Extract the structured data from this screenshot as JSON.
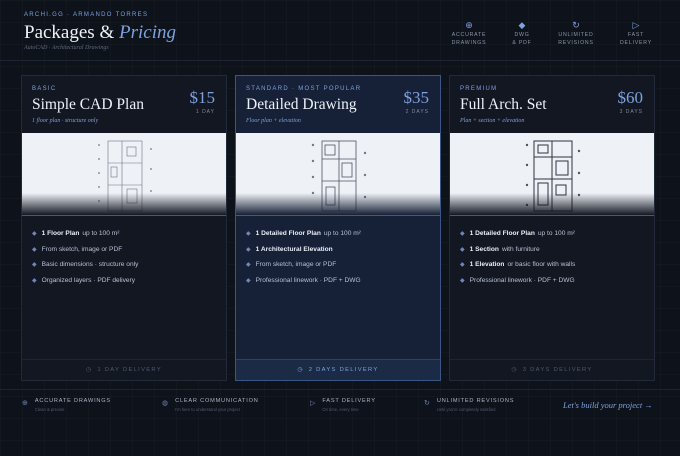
{
  "header": {
    "brand_tag": "ARCHI.GG · ARMANDO TORRES",
    "title_main": "Packages &",
    "title_accent": "Pricing",
    "subtitle": "AutoCAD · Architectural Drawings",
    "features": [
      {
        "icon": "target-icon",
        "glyph": "⊕",
        "line1": "ACCURATE",
        "line2": "DRAWINGS"
      },
      {
        "icon": "diamond-icon",
        "glyph": "◆",
        "line1": "DWG",
        "line2": "& PDF"
      },
      {
        "icon": "refresh-icon",
        "glyph": "↻",
        "line1": "UNLIMITED",
        "line2": "REVISIONS"
      },
      {
        "icon": "play-icon",
        "glyph": "▷",
        "line1": "FAST",
        "line2": "DELIVERY"
      }
    ]
  },
  "plans": [
    {
      "tier": "BASIC",
      "name": "Simple CAD Plan",
      "subtitle": "1 floor plan · structure only",
      "price": "$15",
      "days": "1 DAY",
      "delivery": "1 DAY DELIVERY",
      "features": [
        {
          "bold": "1 Floor Plan",
          "text": "up to 100 m²"
        },
        {
          "bold": "",
          "text": "From sketch, image or PDF"
        },
        {
          "bold": "",
          "text": "Basic dimensions · structure only"
        },
        {
          "bold": "",
          "text": "Organized layers · PDF delivery"
        }
      ]
    },
    {
      "tier": "STANDARD · MOST POPULAR",
      "name": "Detailed Drawing",
      "subtitle": "Floor plan + elevation",
      "price": "$35",
      "days": "2 DAYS",
      "delivery": "2 DAYS DELIVERY",
      "features": [
        {
          "bold": "1 Detailed Floor Plan",
          "text": "up to 100 m²"
        },
        {
          "bold": "1 Architectural Elevation",
          "text": ""
        },
        {
          "bold": "",
          "text": "From sketch, image or PDF"
        },
        {
          "bold": "",
          "text": "Professional linework · PDF + DWG"
        }
      ]
    },
    {
      "tier": "PREMIUM",
      "name": "Full Arch. Set",
      "subtitle": "Plan + section + elevation",
      "price": "$60",
      "days": "3 DAYS",
      "delivery": "3 DAYS DELIVERY",
      "features": [
        {
          "bold": "1 Detailed Floor Plan",
          "text": "up to 100 m²"
        },
        {
          "bold": "1 Section",
          "text": "with furniture"
        },
        {
          "bold": "1 Elevation",
          "text": "or basic floor with walls"
        },
        {
          "bold": "",
          "text": "Professional linework · PDF + DWG"
        }
      ]
    }
  ],
  "footer": {
    "features": [
      {
        "icon": "target-icon",
        "glyph": "⊕",
        "title": "ACCURATE DRAWINGS",
        "sub": "Clean & precise"
      },
      {
        "icon": "chat-icon",
        "glyph": "◍",
        "title": "CLEAR COMMUNICATION",
        "sub": "I'm here to understand your project"
      },
      {
        "icon": "play-icon",
        "glyph": "▷",
        "title": "FAST DELIVERY",
        "sub": "On time, every time"
      },
      {
        "icon": "refresh-icon",
        "glyph": "↻",
        "title": "UNLIMITED REVISIONS",
        "sub": "Until you're completely satisfied"
      }
    ],
    "cta": "Let's build your project →"
  }
}
